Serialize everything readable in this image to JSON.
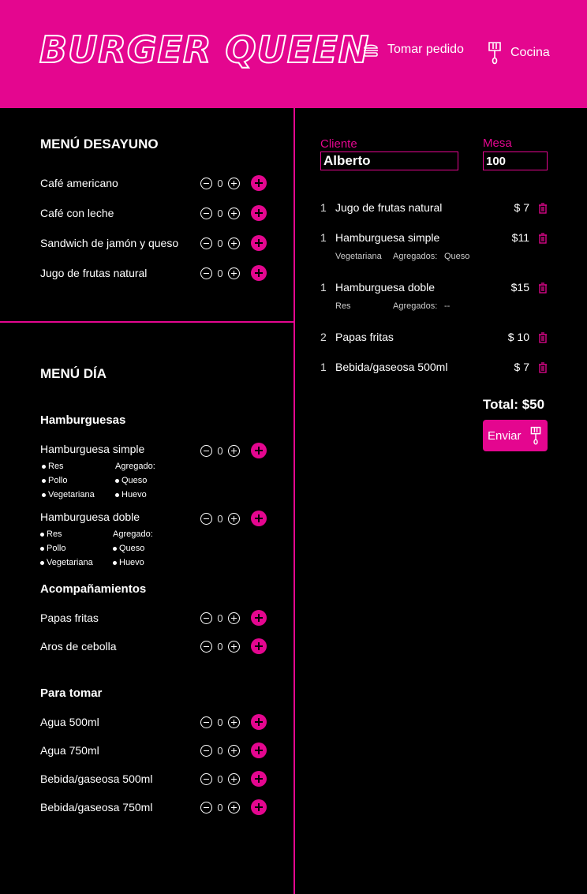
{
  "brand": "BURGER QUEEN",
  "nav": {
    "order": "Tomar pedido",
    "kitchen": "Cocina"
  },
  "breakfast": {
    "title": "MENÚ DESAYUNO",
    "items": [
      {
        "name": "Café americano",
        "qty": "0"
      },
      {
        "name": "Café con leche",
        "qty": "0"
      },
      {
        "name": "Sandwich de jamón y queso",
        "qty": "0"
      },
      {
        "name": "Jugo de frutas natural",
        "qty": "0"
      }
    ]
  },
  "day": {
    "title": "MENÚ DÍA",
    "burgers_title": "Hamburguesas",
    "burgers": [
      {
        "name": "Hamburguesa simple",
        "qty": "0",
        "types": [
          "Res",
          "Pollo",
          "Vegetariana"
        ],
        "extras_label": "Agregado:",
        "extras": [
          "Queso",
          "Huevo"
        ]
      },
      {
        "name": "Hamburguesa doble",
        "qty": "0",
        "types": [
          "Res",
          "Pollo",
          "Vegetariana"
        ],
        "extras_label": "Agregado:",
        "extras": [
          "Queso",
          "Huevo"
        ]
      }
    ],
    "sides_title": "Acompañamientos",
    "sides": [
      {
        "name": "Papas fritas",
        "qty": "0"
      },
      {
        "name": "Aros de cebolla",
        "qty": "0"
      }
    ],
    "drinks_title": "Para tomar",
    "drinks": [
      {
        "name": "Agua 500ml",
        "qty": "0"
      },
      {
        "name": "Agua 750ml",
        "qty": "0"
      },
      {
        "name": "Bebida/gaseosa 500ml",
        "qty": "0"
      },
      {
        "name": "Bebida/gaseosa 750ml",
        "qty": "0"
      }
    ]
  },
  "order": {
    "client_label": "Cliente",
    "client_value": "Alberto",
    "table_label": "Mesa",
    "table_value": "100",
    "lines": [
      {
        "qty": "1",
        "name": "Jugo de frutas natural",
        "price": "$ 7"
      },
      {
        "qty": "1",
        "name": "Hamburguesa simple",
        "price": "$11",
        "type": "Vegetariana",
        "extras_label": "Agregados:",
        "extras": "Queso"
      },
      {
        "qty": "1",
        "name": "Hamburguesa doble",
        "price": "$15",
        "type": "Res",
        "extras_label": "Agregados:",
        "extras": "--"
      },
      {
        "qty": "2",
        "name": "Papas fritas",
        "price": "$ 10"
      },
      {
        "qty": "1",
        "name": "Bebida/gaseosa 500ml",
        "price": "$ 7"
      }
    ],
    "total": "Total: $50",
    "send_label": "Enviar"
  },
  "colors": {
    "accent": "#e4068f",
    "background": "#000000",
    "text": "#ffffff"
  }
}
